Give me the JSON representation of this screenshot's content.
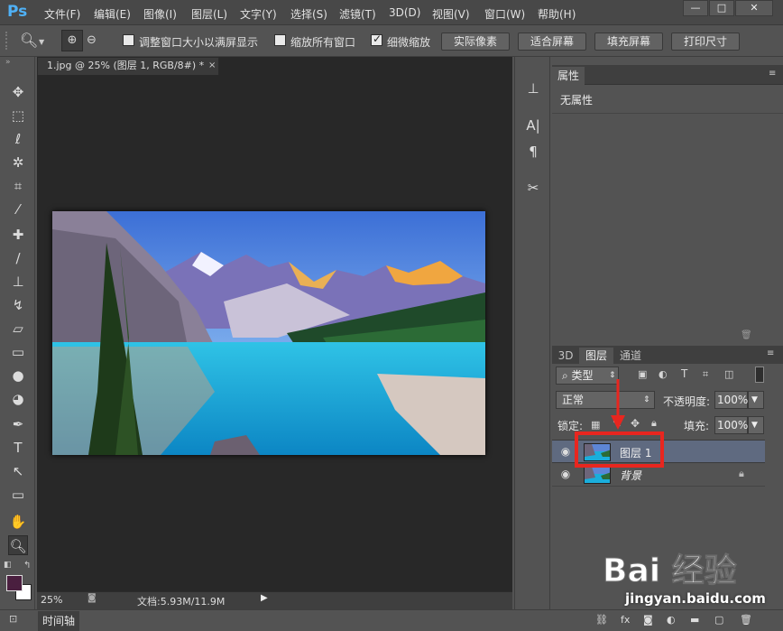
{
  "app": {
    "logo": "Ps"
  },
  "menu": [
    "文件(F)",
    "编辑(E)",
    "图像(I)",
    "图层(L)",
    "文字(Y)",
    "选择(S)",
    "滤镜(T)",
    "3D(D)",
    "视图(V)",
    "窗口(W)",
    "帮助(H)"
  ],
  "window_buttons": {
    "minimize": "—",
    "restore": "□",
    "close": "✕"
  },
  "options": {
    "resize_windows": "调整窗口大小以满屏显示",
    "resize_windows_checked": false,
    "zoom_all": "缩放所有窗口",
    "zoom_all_checked": false,
    "scrubby_zoom": "细微缩放",
    "scrubby_zoom_checked": true,
    "actual_pixels": "实际像素",
    "fit_screen": "适合屏幕",
    "fill_screen": "填充屏幕",
    "print_size": "打印尺寸"
  },
  "document": {
    "tab_title": "1.jpg @ 25% (图层 1, RGB/8#) *",
    "close": "×"
  },
  "status": {
    "zoom": "25%",
    "doc_info": "文档:5.93M/11.9M"
  },
  "timeline": {
    "label": "时间轴"
  },
  "properties": {
    "tab": "属性",
    "content": "无属性"
  },
  "layers_panel": {
    "tabs": [
      "3D",
      "图层",
      "通道"
    ],
    "active_tab": "图层",
    "filter_kind": "类型",
    "blend_mode": "正常",
    "opacity_label": "不透明度:",
    "opacity_value": "100%",
    "lock_label": "锁定:",
    "fill_label": "填充:",
    "fill_value": "100%",
    "layers": [
      {
        "name": "图层 1",
        "visible": true,
        "selected": true
      },
      {
        "name": "背景",
        "visible": true,
        "selected": false,
        "locked": true
      }
    ]
  },
  "watermark": {
    "brand": "Bai 经验",
    "url": "jingyan.baidu.com"
  },
  "colors": {
    "accent": "#4fb1f6",
    "highlight": "#e8261f",
    "foreground": "#4a1f3f",
    "background": "#ffffff"
  },
  "dock_icons": [
    "stamp-icon",
    "character-icon",
    "paragraph-icon",
    "tools-icon"
  ]
}
